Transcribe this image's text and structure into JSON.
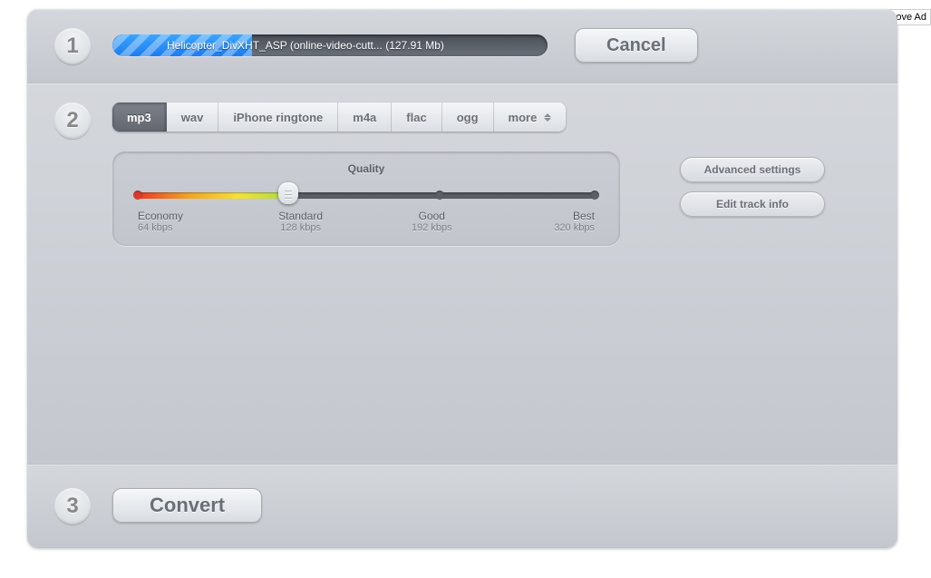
{
  "remove_ads_label": "Remove Ad",
  "step1": {
    "number": "1",
    "file_label": "Helicopter_DivXHT_ASP (online-video-cutt... (127.91 Mb)",
    "progress_percent": 32,
    "cancel_label": "Cancel"
  },
  "step2": {
    "number": "2",
    "formats": [
      "mp3",
      "wav",
      "iPhone ringtone",
      "m4a",
      "flac",
      "ogg",
      "more"
    ],
    "selected_format_index": 0,
    "quality_title": "Quality",
    "quality_options": [
      {
        "label": "Economy",
        "bitrate": "64 kbps",
        "position": 0
      },
      {
        "label": "Standard",
        "bitrate": "128 kbps",
        "position": 33
      },
      {
        "label": "Good",
        "bitrate": "192 kbps",
        "position": 66
      },
      {
        "label": "Best",
        "bitrate": "320 kbps",
        "position": 100
      }
    ],
    "selected_quality_index": 1,
    "advanced_label": "Advanced settings",
    "track_info_label": "Edit track info"
  },
  "step3": {
    "number": "3",
    "convert_label": "Convert"
  }
}
